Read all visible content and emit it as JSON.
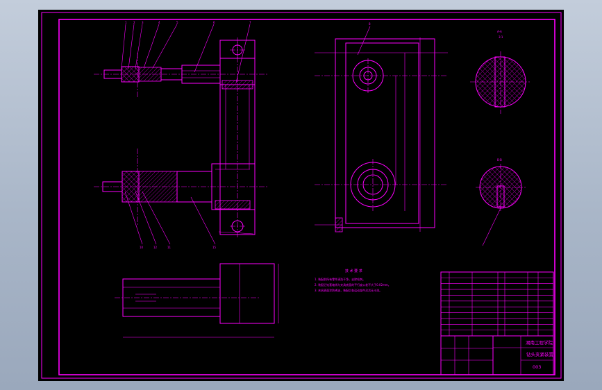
{
  "colors": {
    "background": "#000000",
    "linework": "#ff00ff",
    "window": "#b3bfd0"
  },
  "leaders_top": [
    "1",
    "2",
    "3",
    "4",
    "5",
    "6",
    "7"
  ],
  "leader_a": "8",
  "leaders_bottom": [
    "10",
    "12",
    "11",
    "15"
  ],
  "section_aa": {
    "title": "A-A",
    "subtitle": "3:1"
  },
  "section_bb": {
    "title": "B-B"
  },
  "notes_heading": "技 术 要 求",
  "notes": [
    "1. 装配前所有零件清洗干净，去除毛刺。",
    "2. 装配后钻套轴线与夹具底面的平行度公差不大于0.02mm。",
    "3. 夹具表面涂防锈油，装配后各运动部件灵活无卡滞。"
  ],
  "title_block": {
    "school": "湖南工程学院",
    "drawing_title": "钻头夹紧装置",
    "drawing_number": "003"
  },
  "parts_rows": 11
}
